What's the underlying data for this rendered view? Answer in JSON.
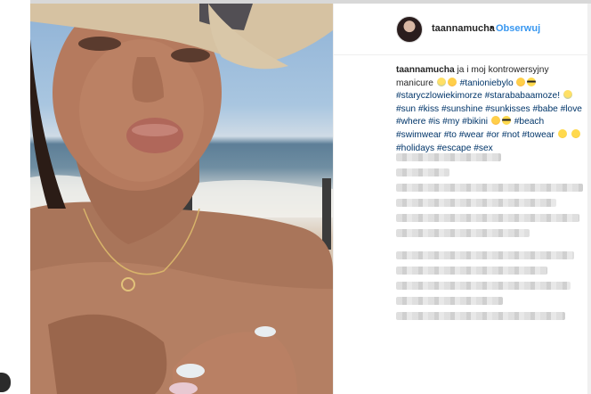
{
  "post": {
    "username": "taannamucha",
    "separator": "•",
    "follow_label": "Obserwuj",
    "caption": {
      "author": "taannamucha",
      "text_1": " ja i moj kontrowersyjny manicure ",
      "tags_line_1": "#tanioniebylo",
      "tags_line_2": "#staryczlowiekimorze #starababaamoze!",
      "tags_line_3": "#sun #kiss #sunshine #sunkisses #babe #love #where #is #my #bikini",
      "tags_line_4": "#beach #swimwear #to #wear #or #not #towear",
      "tags_line_5": "#holidays #escape #sex"
    }
  },
  "colors": {
    "link": "#3897f0",
    "hashtag": "#003569",
    "text": "#262626"
  },
  "icons": {
    "avatar": "profile-avatar",
    "emoji": "emoji-icon"
  }
}
